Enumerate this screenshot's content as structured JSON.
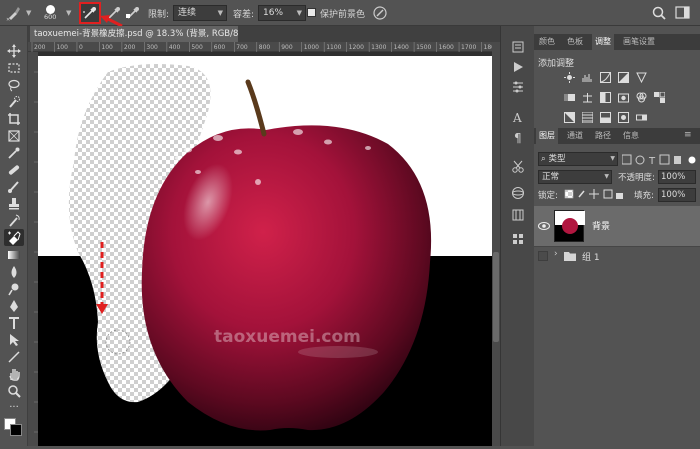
{
  "options_bar": {
    "brush_size": "600",
    "limit_label": "限制:",
    "limit_value": "连续",
    "tolerance_label": "容差:",
    "tolerance_value": "16%",
    "protect_fg_label": "保护前景色"
  },
  "document": {
    "tab_title": "taoxuemei-背景橡皮擦.psd @ 18.3% (背景, RGB/8) *",
    "watermark": "taoxuemei.com",
    "ruler_ticks": [
      "200",
      "100",
      "0",
      "100",
      "200",
      "300",
      "400",
      "500",
      "600",
      "700",
      "800",
      "900",
      "1000",
      "1100",
      "1200",
      "1300",
      "1400",
      "1500",
      "1600",
      "1700",
      "180"
    ]
  },
  "adjust_panel": {
    "tabs": [
      "颜色",
      "色板",
      "调整",
      "画笔设置"
    ],
    "active_tab": "调整",
    "heading": "添加调整"
  },
  "layers_panel": {
    "tabs": [
      "图层",
      "通道",
      "路径",
      "信息"
    ],
    "active_tab": "图层",
    "filter_label": "类型",
    "blend_mode": "正常",
    "opacity_label": "不透明度:",
    "opacity_value": "100%",
    "lock_label": "锁定:",
    "fill_label": "填充:",
    "fill_value": "100%",
    "layers": [
      {
        "name": "背景",
        "visible": true,
        "selected": true
      },
      {
        "name": "组 1",
        "visible": false,
        "selected": false
      }
    ]
  },
  "colors": {
    "accent_red": "#e02020",
    "panel_bg": "#535353",
    "selected_layer": "#6b6b6b"
  }
}
